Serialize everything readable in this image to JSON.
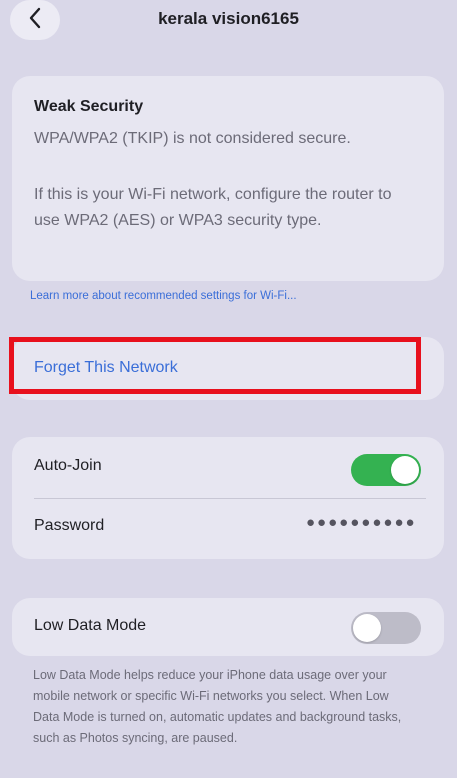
{
  "header": {
    "title": "kerala vision6165",
    "back_icon": "chevron-left-icon"
  },
  "security_notice": {
    "heading": "Weak Security",
    "line1": "WPA/WPA2 (TKIP) is not considered secure.",
    "paragraph": "If this is your Wi-Fi network, configure the router to use WPA2 (AES) or WPA3 security type."
  },
  "learn_more_link": "Learn more about recommended settings for Wi-Fi...",
  "forget_network": {
    "label": "Forget This Network"
  },
  "settings": {
    "auto_join_label": "Auto-Join",
    "auto_join_on": true,
    "password_label": "Password",
    "password_mask": "●●●●●●●●●●"
  },
  "low_data_mode": {
    "label": "Low Data Mode",
    "enabled": false,
    "description": "Low Data Mode helps reduce your iPhone data usage over your mobile network or specific Wi-Fi networks you select. When Low Data Mode is turned on, automatic updates and background tasks, such as Photos syncing, are paused."
  },
  "colors": {
    "background": "#d9d7e8",
    "card": "#e7e6f1",
    "link_blue": "#3a6ed8",
    "toggle_on": "#34b251",
    "toggle_off": "#bdbcc8",
    "highlight_red": "#e8101d"
  }
}
